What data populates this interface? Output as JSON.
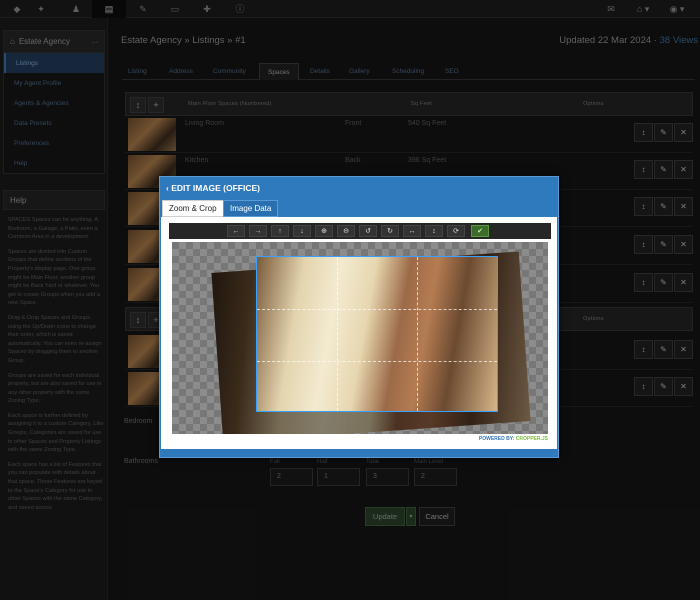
{
  "topbar": {
    "icons": [
      "logo-icon",
      "rocket-icon",
      "users-icon",
      "document-icon",
      "wrench-icon",
      "desktop-icon",
      "puzzle-icon",
      "info-icon"
    ],
    "right_icons": [
      "mail-icon",
      "home-icon",
      "user-menu-icon"
    ]
  },
  "sidebar": {
    "title": "Estate Agency",
    "dots": "...",
    "items": [
      {
        "label": "Listings",
        "active": true
      },
      {
        "label": "My Agent Profile"
      },
      {
        "label": "Agents & Agencies"
      },
      {
        "label": "Data Presets"
      },
      {
        "label": "Preferences"
      },
      {
        "label": "Help"
      }
    ],
    "help_title": "Help",
    "help_paragraphs": [
      "SPACES Spaces can be anything. A Bedroom, a Garage, a Patio, even a Common Area in a development.",
      "Spaces are divided into Custom Groups that define sections of the Property's display page. One group might be Main Floor, another group might be Back Yard or whatever. You get to create Groups when you add a new Space.",
      "Drag & Drop Spaces and Groups using the Up/Down icons to change their order, which is saved automatically. You can even re-assign Spaces by dragging them to another Group.",
      "Groups are saved for each individual property, but are also saved for use in any other property with the same Zoning Type.",
      "Each space is further defined by assigning it to a custom Category. Like Groups, Categories are saved for use in other Spaces and Property Listings with the same Zoning Type.",
      "Each space has a list of Features that you can populate with details about that space. These Features are keyed to the Space's Category for use in other Spaces with the same Category, and saved across"
    ]
  },
  "header": {
    "breadcrumb": "Estate Agency » Listings » #1",
    "updated": "Updated 22 Mar 2024 · ",
    "views": "38 Views"
  },
  "tabs": [
    "Listing",
    "Address",
    "Community",
    "Spaces",
    "Details",
    "Gallery",
    "Scheduling",
    "SEO"
  ],
  "active_tab": "Spaces",
  "table": {
    "group_title": "Main Floor Spaces (Numbered)",
    "col_size": "Sq Feet",
    "col_options": "Options",
    "rows": [
      {
        "name": "Living Room",
        "location": "Front",
        "size": "540 Sq Feet"
      },
      {
        "name": "Kitchen",
        "location": "Back",
        "size": "396 Sq Feet"
      }
    ],
    "second_options": "Options"
  },
  "summary": {
    "bedrooms_label": "Bedroom",
    "bathrooms_label": "Bathrooms",
    "fields": [
      {
        "label": "Full",
        "value": "2"
      },
      {
        "label": "Half",
        "value": "1"
      },
      {
        "label": "Total",
        "value": "3"
      },
      {
        "label": "Main Level",
        "value": "2"
      }
    ]
  },
  "buttons": {
    "update": "Update",
    "cancel": "Cancel"
  },
  "modal": {
    "title": "EDIT IMAGE (OFFICE)",
    "tab_zoom": "Zoom & Crop",
    "tab_data": "Image Data",
    "toolbar": [
      "←",
      "→",
      "↑",
      "↓",
      "⊕",
      "⊖",
      "↺",
      "↻",
      "↔",
      "↕",
      "⟳",
      "✔"
    ],
    "toolbar_names": [
      "move-left-icon",
      "move-right-icon",
      "move-up-icon",
      "move-down-icon",
      "zoom-in-icon",
      "zoom-out-icon",
      "rotate-left-icon",
      "rotate-right-icon",
      "flip-horizontal-icon",
      "flip-vertical-icon",
      "reset-icon",
      "check-icon"
    ],
    "powered_prefix": "POWERED BY: ",
    "powered_lib": "CROPPER.JS"
  }
}
